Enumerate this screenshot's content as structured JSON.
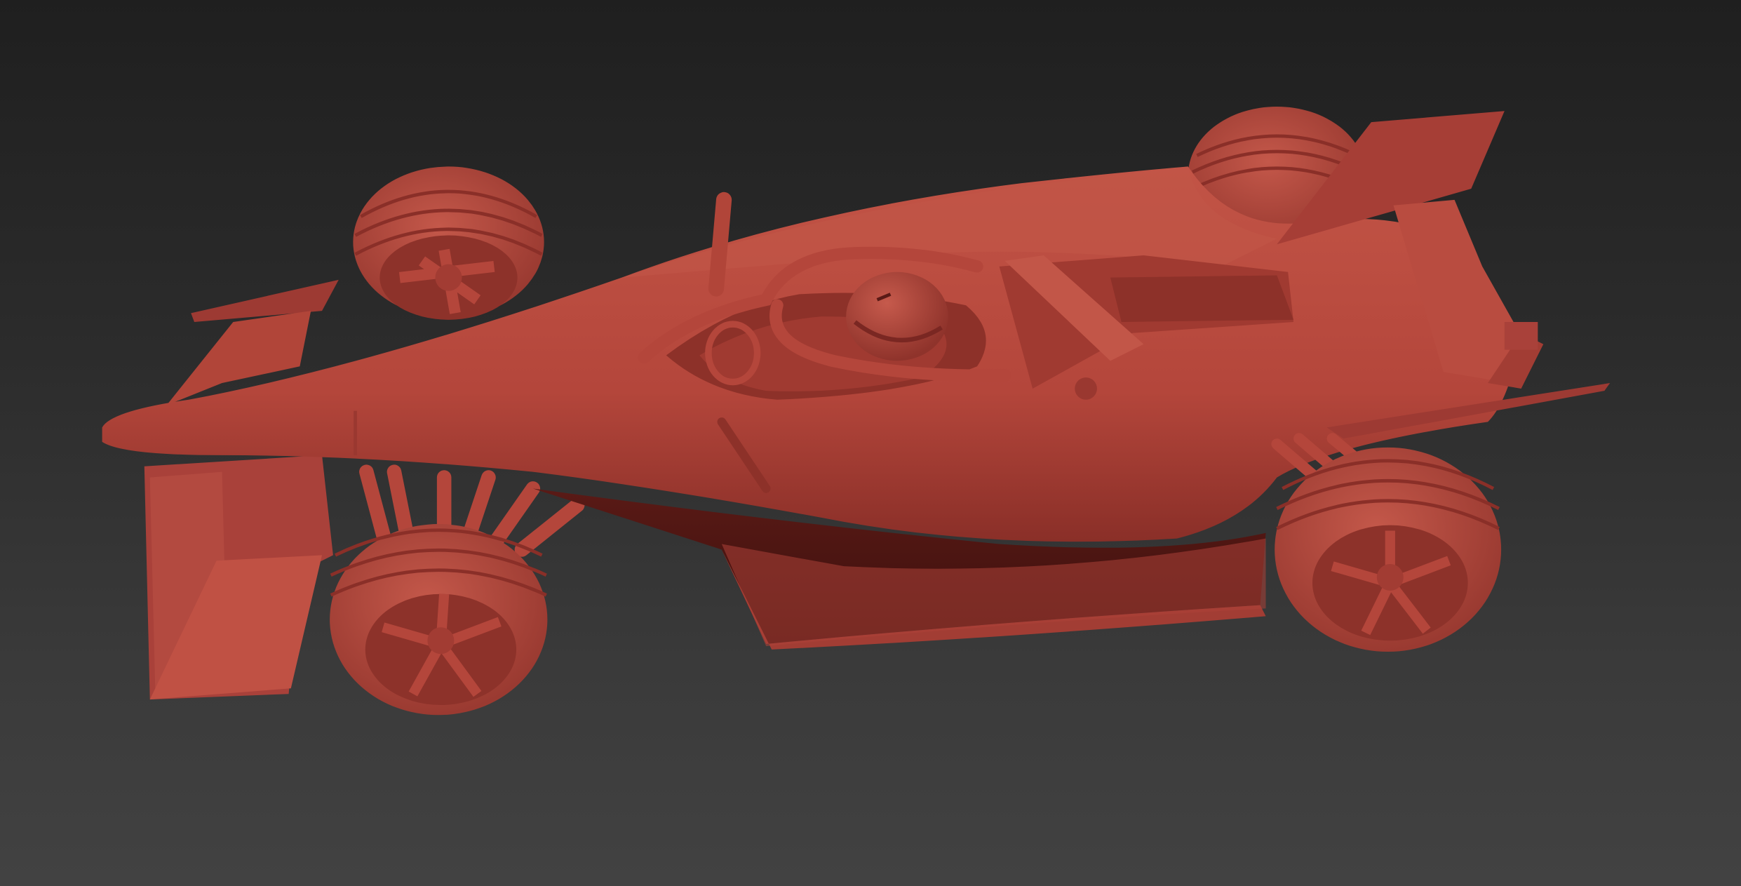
{
  "viewport": {
    "description_free": true,
    "background_top": "#1f1f1f",
    "background_bottom": "#424242"
  },
  "model": {
    "clay_color": "#b5473c",
    "clay_light": "#c9584a",
    "clay_dark": "#7a2722",
    "clay_shadow": "#4a1512"
  }
}
